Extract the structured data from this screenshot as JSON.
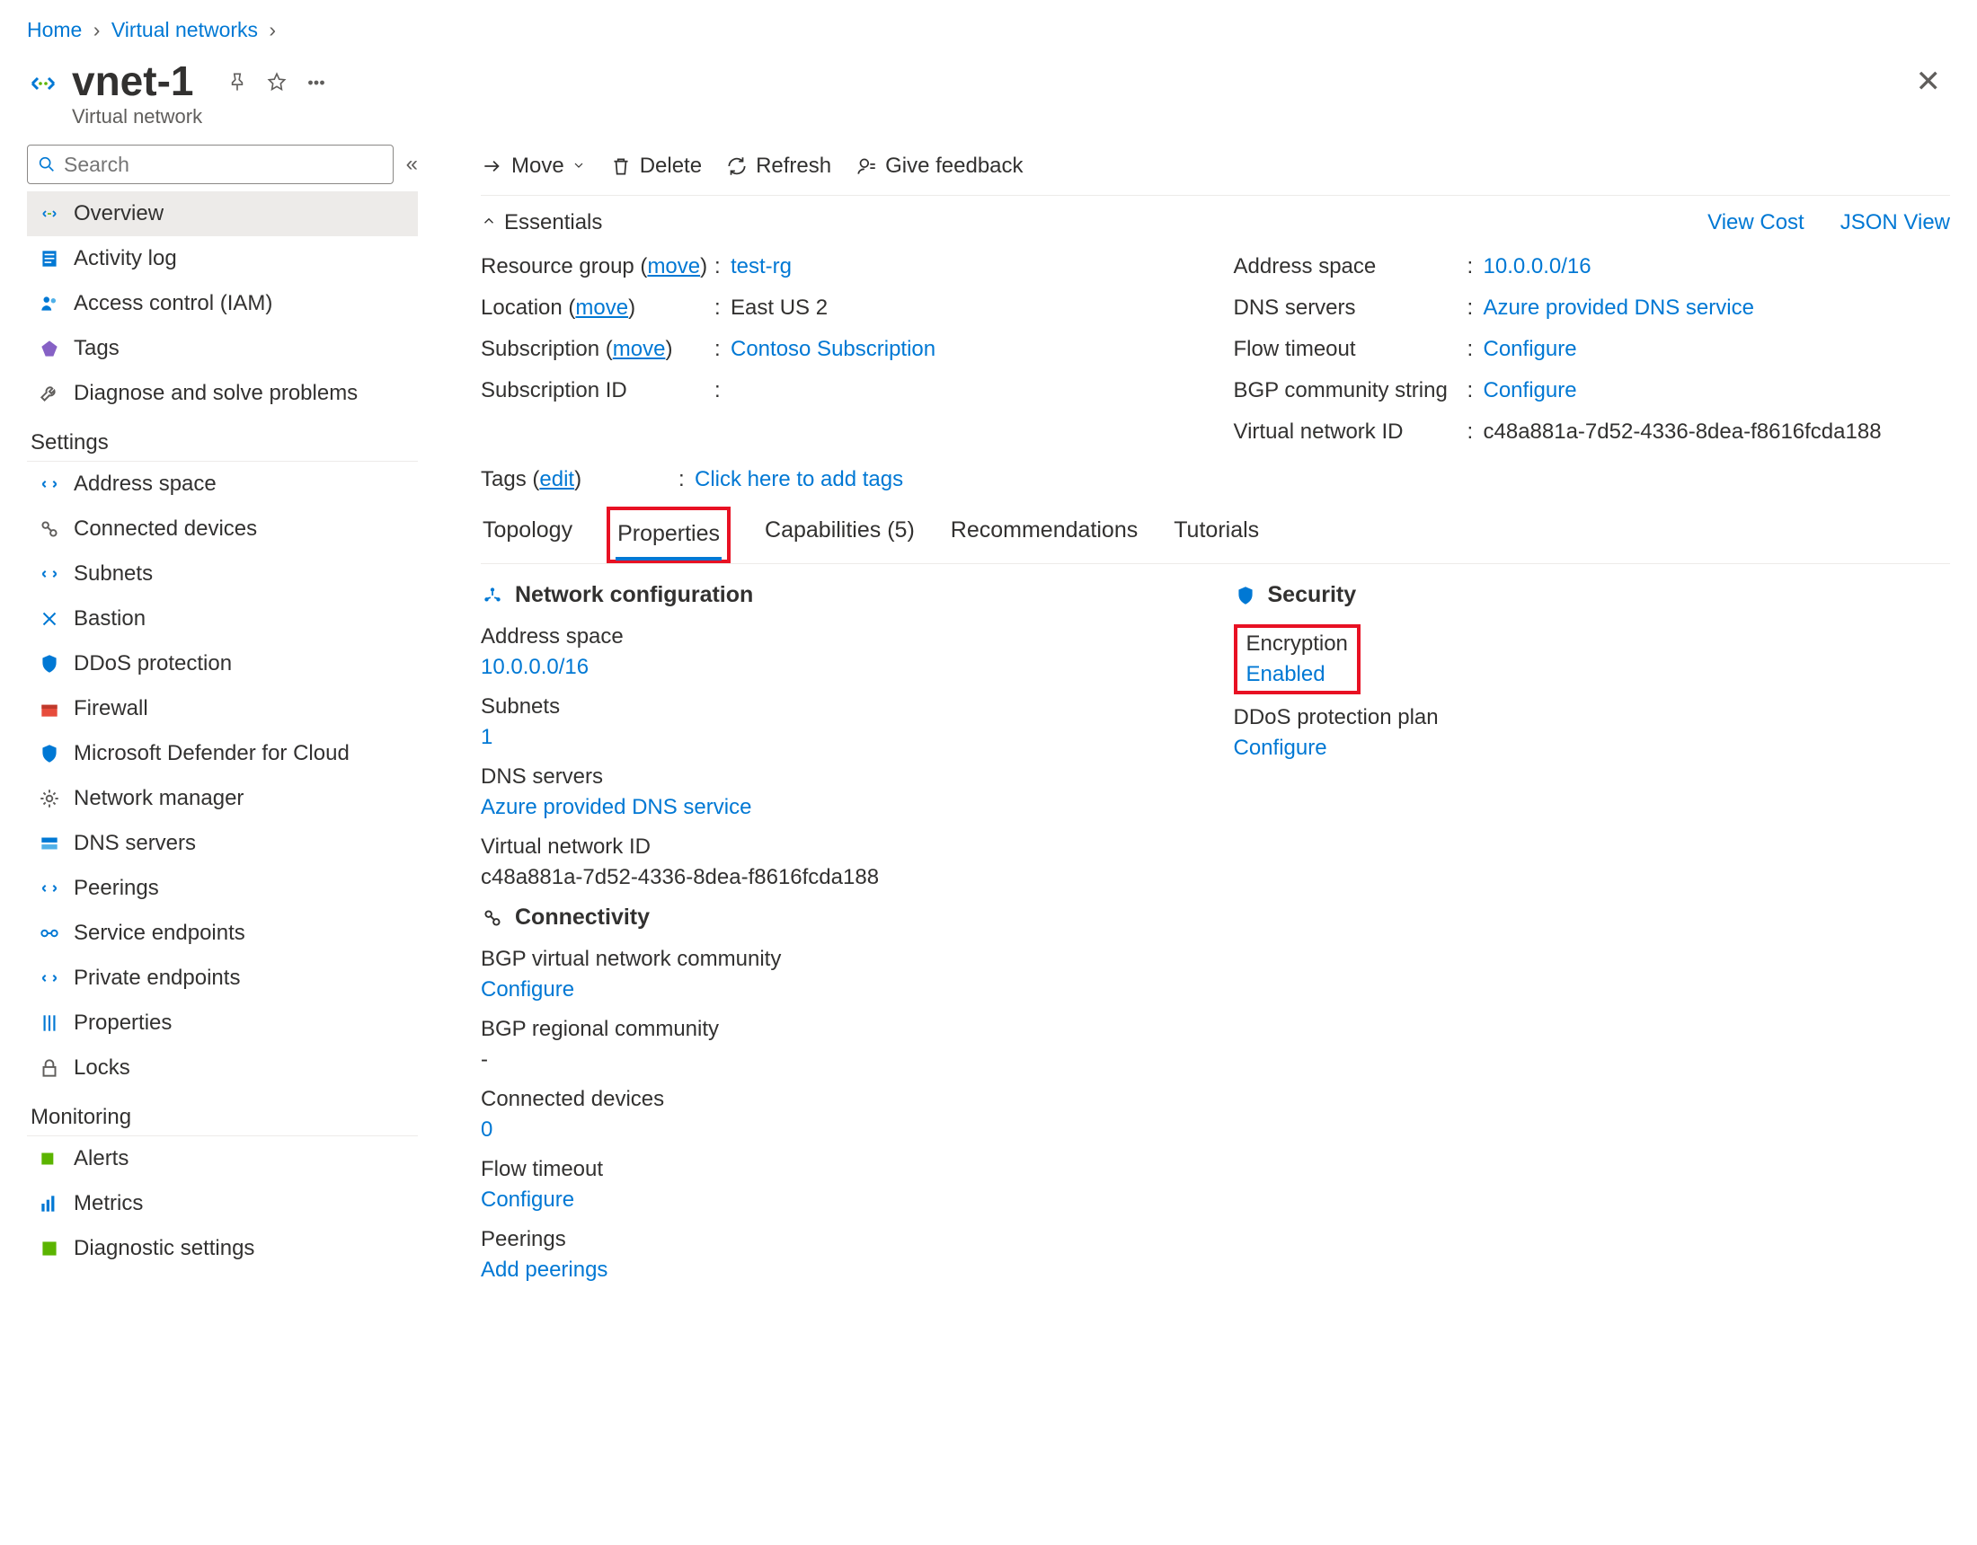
{
  "breadcrumbs": {
    "home": "Home",
    "vn": "Virtual networks"
  },
  "header": {
    "title": "vnet-1",
    "subtitle": "Virtual network"
  },
  "search": {
    "placeholder": "Search"
  },
  "nav": {
    "overview": "Overview",
    "activity": "Activity log",
    "iam": "Access control (IAM)",
    "tags": "Tags",
    "diagnose": "Diagnose and solve problems",
    "sec_settings": "Settings",
    "addr": "Address space",
    "devices": "Connected devices",
    "subnets": "Subnets",
    "bastion": "Bastion",
    "ddos": "DDoS protection",
    "fw": "Firewall",
    "defender": "Microsoft Defender for Cloud",
    "netmgr": "Network manager",
    "dns": "DNS servers",
    "peerings": "Peerings",
    "svcep": "Service endpoints",
    "privep": "Private endpoints",
    "props": "Properties",
    "locks": "Locks",
    "sec_mon": "Monitoring",
    "alerts": "Alerts",
    "metrics": "Metrics",
    "diag": "Diagnostic settings"
  },
  "cmd": {
    "move": "Move",
    "delete": "Delete",
    "refresh": "Refresh",
    "feedback": "Give feedback"
  },
  "ess": {
    "label": "Essentials",
    "viewcost": "View Cost",
    "json": "JSON View",
    "rg_lbl": "Resource group",
    "rg_move": "move",
    "rg_val": "test-rg",
    "loc_lbl": "Location",
    "loc_move": "move",
    "loc_val": "East US 2",
    "sub_lbl": "Subscription",
    "sub_move": "move",
    "sub_val": "Contoso Subscription",
    "subid_lbl": "Subscription ID",
    "subid_val": "",
    "addr_lbl": "Address space",
    "addr_val": "10.0.0.0/16",
    "dns_lbl": "DNS servers",
    "dns_val": "Azure provided DNS service",
    "flow_lbl": "Flow timeout",
    "flow_val": "Configure",
    "bgp_lbl": "BGP community string",
    "bgp_val": "Configure",
    "vnid_lbl": "Virtual network ID",
    "vnid_val": "c48a881a-7d52-4336-8dea-f8616fcda188",
    "tags_lbl": "Tags",
    "tags_edit": "edit",
    "tags_val": "Click here to add tags"
  },
  "tabs": {
    "topology": "Topology",
    "properties": "Properties",
    "caps": "Capabilities (5)",
    "recs": "Recommendations",
    "tut": "Tutorials"
  },
  "netcfg": {
    "head": "Network configuration",
    "addr_lbl": "Address space",
    "addr_val": "10.0.0.0/16",
    "sub_lbl": "Subnets",
    "sub_val": "1",
    "dns_lbl": "DNS servers",
    "dns_val": "Azure provided DNS service",
    "vnid_lbl": "Virtual network ID",
    "vnid_val": "c48a881a-7d52-4336-8dea-f8616fcda188"
  },
  "security": {
    "head": "Security",
    "enc_lbl": "Encryption",
    "enc_val": "Enabled",
    "ddos_lbl": "DDoS protection plan",
    "ddos_val": "Configure"
  },
  "conn": {
    "head": "Connectivity",
    "bgpv_lbl": "BGP virtual network community",
    "bgpv_val": "Configure",
    "bgpr_lbl": "BGP regional community",
    "bgpr_val": "-",
    "dev_lbl": "Connected devices",
    "dev_val": "0",
    "flow_lbl": "Flow timeout",
    "flow_val": "Configure",
    "peer_lbl": "Peerings",
    "peer_val": "Add peerings"
  }
}
